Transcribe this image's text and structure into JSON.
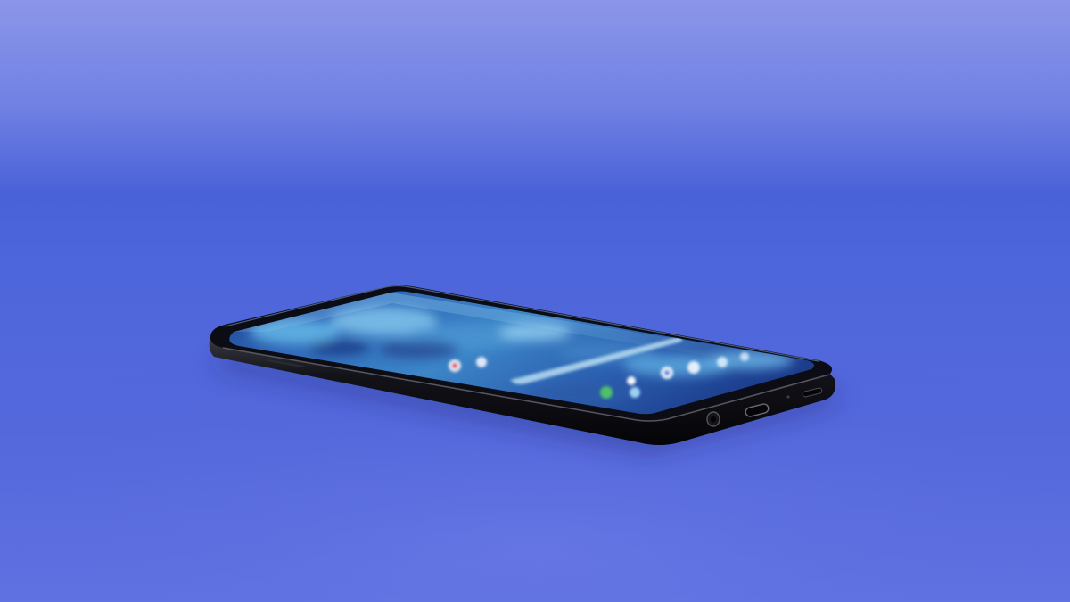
{
  "photo": {
    "subject": "smartphone",
    "colors": {
      "backdrop_top": "#8a93e6",
      "backdrop_mid": "#4e63d6",
      "backdrop_floor": "#5a6ee0",
      "phone_body": "#0c0d14",
      "phone_edge_highlight": "#6b6a6e",
      "screen_dark": "#1f3f8f",
      "screen_light": "#5fb6e6"
    },
    "icons": [
      "usb-c-port-icon",
      "headphone-jack-icon",
      "speaker-grille-icon",
      "search-bar-widget",
      "app-icon"
    ]
  }
}
